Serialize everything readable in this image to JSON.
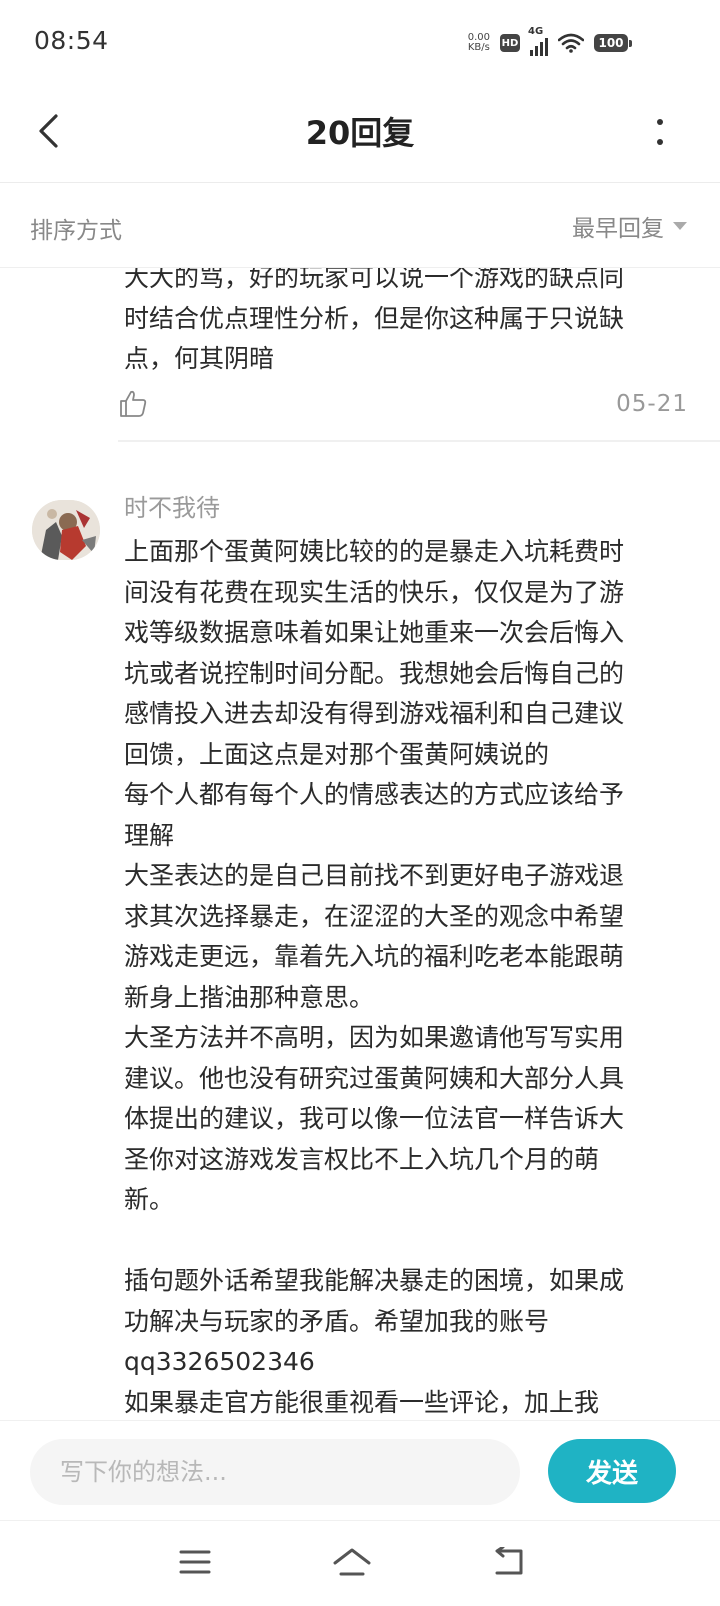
{
  "status_bar": {
    "time": "08:54",
    "net_speed_value": "0.00",
    "net_speed_unit": "KB/s",
    "hd_label": "HD",
    "network_type": "4G",
    "battery": "100",
    "icons": [
      "hd-icon",
      "signal-icon",
      "wifi-icon",
      "battery-icon"
    ]
  },
  "header": {
    "title": "20回复",
    "back_icon": "chevron-left-icon",
    "more_icon": "more-vertical-icon"
  },
  "sort": {
    "label": "排序方式",
    "value": "最早回复",
    "icon": "caret-down-icon"
  },
  "previous_comment": {
    "text": "大大的骂，好的玩家可以说一个游戏的缺点同\n时结合优点理性分析，但是你这种属于只说缺\n点，何其阴暗",
    "date": "05-21",
    "like_icon": "thumbs-up-icon"
  },
  "comment": {
    "username": "时不我待",
    "text": "上面那个蛋黄阿姨比较的的是暴走入坑耗费时\n间没有花费在现实生活的快乐，仅仅是为了游\n戏等级数据意味着如果让她重来一次会后悔入\n坑或者说控制时间分配。我想她会后悔自己的\n感情投入进去却没有得到游戏福利和自己建议\n回馈，上面这点是对那个蛋黄阿姨说的\n每个人都有每个人的情感表达的方式应该给予\n理解\n大圣表达的是自己目前找不到更好电子游戏退\n求其次选择暴走，在涩涩的大圣的观念中希望\n游戏走更远，靠着先入坑的福利吃老本能跟萌\n新身上揩油那种意思。\n大圣方法并不高明，因为如果邀请他写写实用\n建议。他也没有研究过蛋黄阿姨和大部分人具\n体提出的建议，我可以像一位法官一样告诉大\n圣你对这游戏发言权比不上入坑几个月的萌\n新。\n\n插句题外话希望我能解决暴走的困境，如果成\n功解决与玩家的矛盾。希望加我的账号\nqq3326502346\n如果暴走官方能很重视看一些评论，加上我"
  },
  "input_bar": {
    "placeholder": "写下你的想法...",
    "send_label": "发送"
  },
  "nav_bar": {
    "icons": [
      "menu-icon",
      "home-icon",
      "back-icon"
    ]
  },
  "colors": {
    "accent": "#1fb3c4",
    "text_primary": "#2b2b2b",
    "text_secondary": "#999999"
  }
}
